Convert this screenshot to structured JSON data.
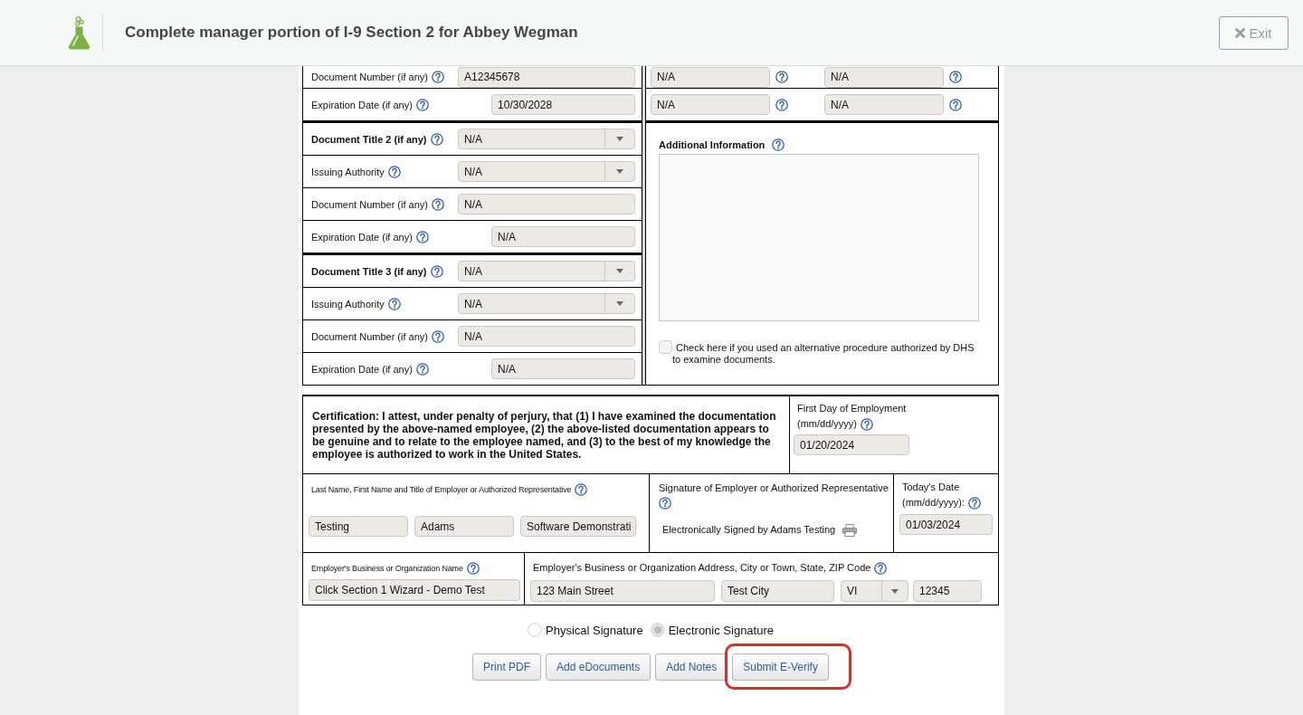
{
  "header": {
    "title": "Complete manager portion of I-9 Section 2 for Abbey Wegman",
    "exit_button": "Exit"
  },
  "documents": [
    {
      "kind": "number",
      "label": "Document Number (if any)",
      "value": "A12345678"
    },
    {
      "kind": "date",
      "label": "Expiration Date (if any)",
      "value": "10/30/2028"
    },
    {
      "kind": "title",
      "label": "Document Title 2 (if any)",
      "value": "N/A"
    },
    {
      "kind": "select",
      "label": "Issuing Authority",
      "value": "N/A"
    },
    {
      "kind": "number",
      "label": "Document Number (if any)",
      "value": "N/A"
    },
    {
      "kind": "date",
      "label": "Expiration Date (if any)",
      "value": "N/A"
    },
    {
      "kind": "title",
      "label": "Document Title 3 (if any)",
      "value": "N/A"
    },
    {
      "kind": "select",
      "label": "Issuing Authority",
      "value": "N/A"
    },
    {
      "kind": "number",
      "label": "Document Number (if any)",
      "value": "N/A"
    },
    {
      "kind": "date",
      "label": "Expiration Date (if any)",
      "value": "N/A"
    }
  ],
  "side_rows": [
    {
      "fields": [
        "N/A",
        "N/A"
      ]
    },
    {
      "fields": [
        "N/A",
        "N/A"
      ]
    }
  ],
  "additional_information": {
    "label": "Additional Information",
    "alternative_procedure": {
      "label": "Check here if you used an alternative procedure authorized by DHS to examine documents.",
      "checked": false
    }
  },
  "certification": {
    "text": "Certification: I attest, under penalty of perjury, that (1) I have examined the documentation presented by the above-named employee, (2) the above-listed documentation appears to be genuine and to relate to the employee named, and (3) to the best of my knowledge the employee is authorized to work in the United States.",
    "first_day": {
      "label": "First Day of Employment",
      "format": "(mm/dd/yyyy)",
      "value": "01/20/2024"
    }
  },
  "employer": {
    "name_title": {
      "label": "Last Name, First Name and Title of Employer or Authorized Representative",
      "values": [
        "Testing",
        "Adams",
        "Software Demonstrati"
      ]
    },
    "signature": {
      "label": "Signature of Employer or Authorized Representative",
      "status": "Electronically Signed by Adams Testing"
    },
    "todays_date": {
      "label": "Today's Date",
      "format": "(mm/dd/yyyy):",
      "value": "01/03/2024"
    },
    "business_name": {
      "label": "Employer's Business or Organization Name",
      "value": "Click Section 1 Wizard - Demo Test"
    },
    "address": {
      "label": "Employer's Business or Organization Address, City or Town, State, ZIP Code",
      "street": "123 Main Street",
      "city": "Test City",
      "state": "VI",
      "zip": "12345"
    }
  },
  "signature_type": [
    {
      "label": "Physical Signature",
      "selected": false
    },
    {
      "label": "Electronic Signature",
      "selected": true
    }
  ],
  "actions": [
    {
      "label": "Print PDF",
      "highlighted": false
    },
    {
      "label": "Add eDocuments",
      "highlighted": false
    },
    {
      "label": "Add Notes",
      "highlighted": false
    },
    {
      "label": "Submit E-Verify",
      "highlighted": true
    }
  ]
}
